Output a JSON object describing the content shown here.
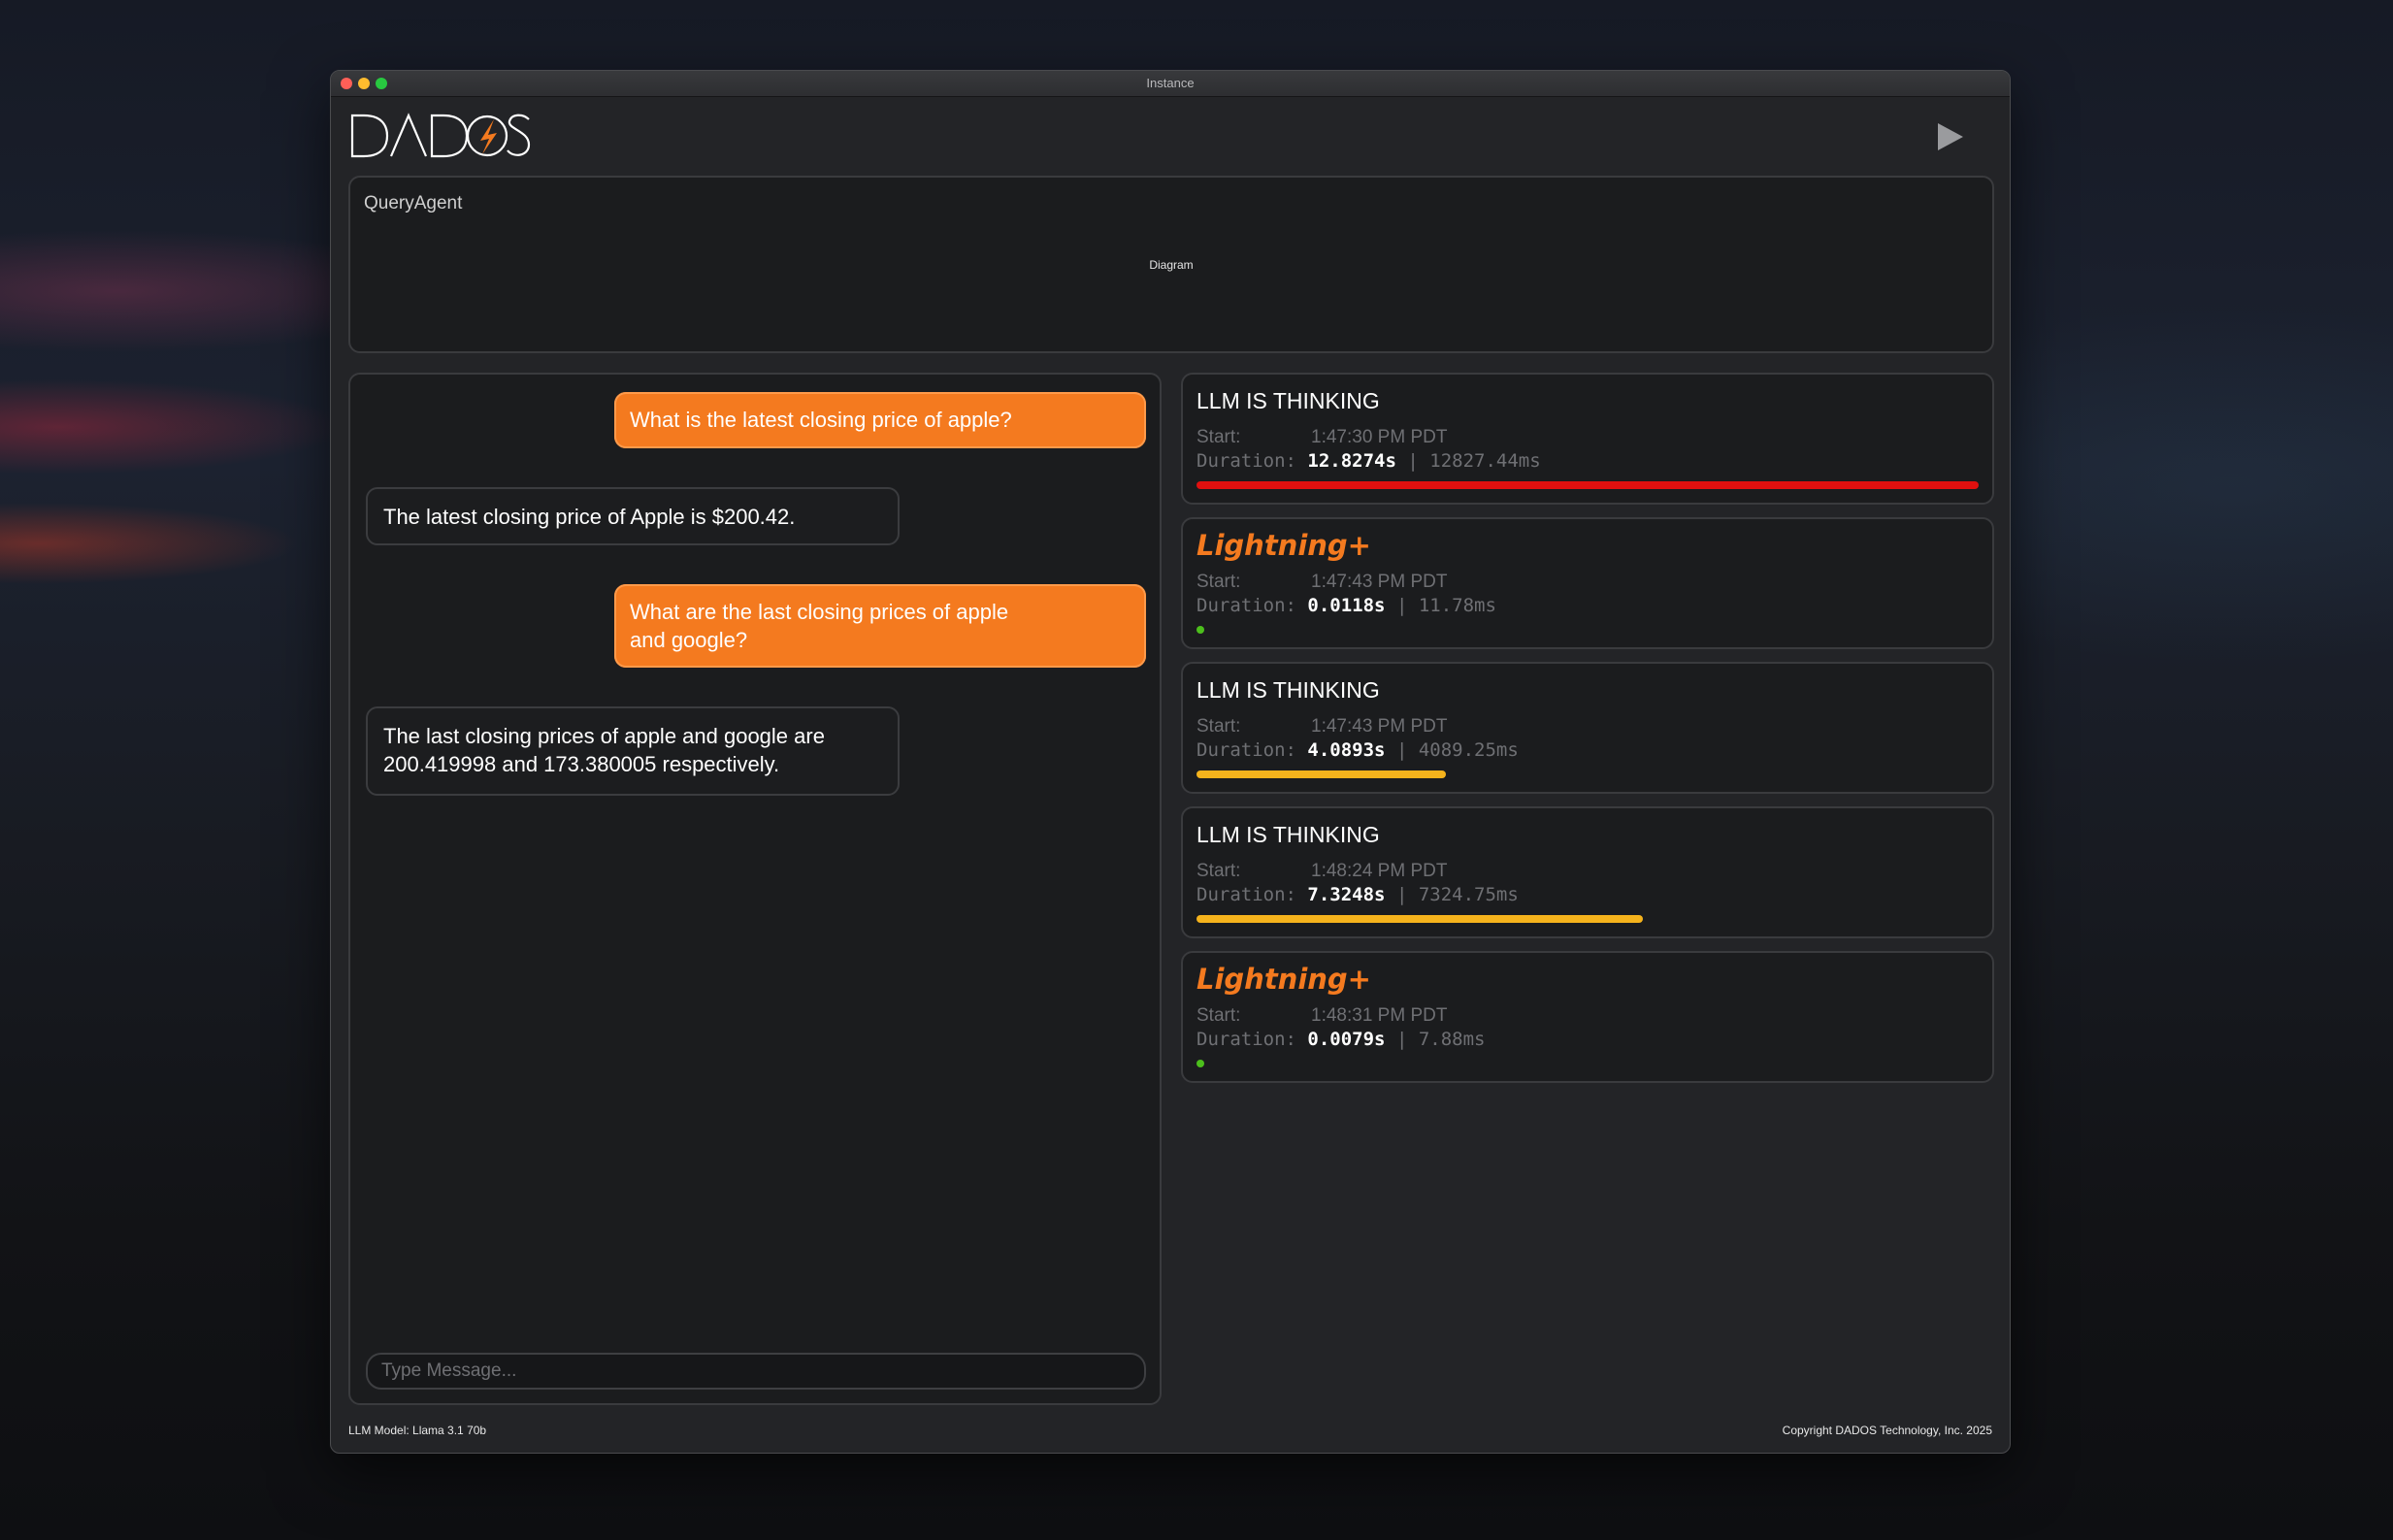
{
  "window": {
    "title": "Instance"
  },
  "app": {
    "logo_text": "DADOS"
  },
  "query_panel": {
    "title": "QueryAgent",
    "diagram_label": "Diagram"
  },
  "chat": {
    "messages": [
      {
        "role": "user",
        "text": "What is the latest closing price of apple?"
      },
      {
        "role": "assistant",
        "text": "The latest closing price of Apple is $200.42."
      },
      {
        "role": "user",
        "text": "What are the last closing prices of apple and google?"
      },
      {
        "role": "assistant",
        "text": "The last closing prices of apple and google are 200.419998 and 173.380005 respectively."
      }
    ],
    "input": {
      "placeholder": "Type Message...",
      "value": ""
    }
  },
  "log": {
    "start_label": "Start:",
    "duration_label": "Duration:",
    "separator": "|",
    "entries": [
      {
        "title": "LLM IS THINKING",
        "brand": false,
        "start": "1:47:30 PM PDT",
        "duration_s": "12.8274s",
        "duration_ms": "12827.44ms",
        "bar_fraction": 1.0,
        "bar_color": "#e0100f"
      },
      {
        "title": "Lightning+",
        "brand": true,
        "start": "1:47:43 PM PDT",
        "duration_s": "0.0118s",
        "duration_ms": "11.78ms",
        "bar_fraction": 0.01,
        "bar_color": "#4cbf1c"
      },
      {
        "title": "LLM IS THINKING",
        "brand": false,
        "start": "1:47:43 PM PDT",
        "duration_s": "4.0893s",
        "duration_ms": "4089.25ms",
        "bar_fraction": 0.319,
        "bar_color": "#f5b31c"
      },
      {
        "title": "LLM IS THINKING",
        "brand": false,
        "start": "1:48:24 PM PDT",
        "duration_s": "7.3248s",
        "duration_ms": "7324.75ms",
        "bar_fraction": 0.571,
        "bar_color": "#f5b31c"
      },
      {
        "title": "Lightning+",
        "brand": true,
        "start": "1:48:31 PM PDT",
        "duration_s": "0.0079s",
        "duration_ms": "7.88ms",
        "bar_fraction": 0.01,
        "bar_color": "#4cbf1c"
      }
    ]
  },
  "footer": {
    "model": "LLM Model: Llama 3.1 70b",
    "copyright": "Copyright DADOS Technology, Inc. 2025"
  },
  "colors": {
    "accent": "#f47a1f",
    "window_bg": "#232427",
    "panel_bg": "#1b1c1e"
  }
}
